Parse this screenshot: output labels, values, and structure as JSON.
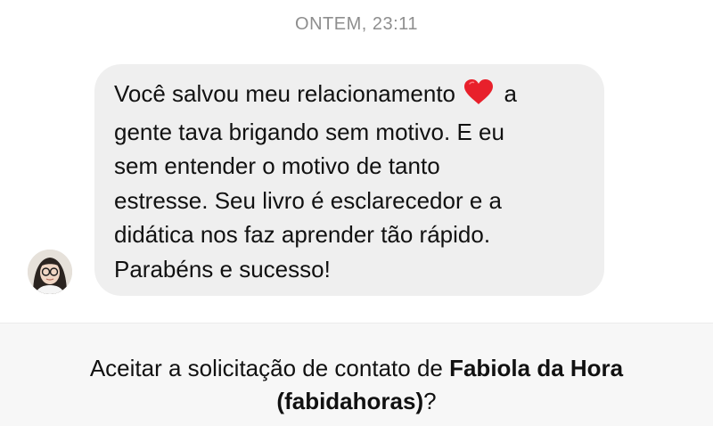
{
  "conversation": {
    "timestamp": "ONTEM, 23:11"
  },
  "message": {
    "avatar_icon": "user-avatar-photo",
    "lines": [
      "Você salvou meu relacionamento",
      "a",
      "gente tava brigando sem motivo. E eu",
      "sem entender o motivo de tanto",
      "estresse. Seu livro é esclarecedor e a",
      "didática nos faz aprender tão rápido.",
      "Parabéns e sucesso!"
    ],
    "emoji": "red-heart-icon"
  },
  "request": {
    "prefix": "Aceitar a solicitação de contato de ",
    "name": "Fabiola da Hora",
    "username": "(fabidahoras)",
    "suffix": "?"
  },
  "colors": {
    "bubble": "#efefef",
    "timestamp": "#8e8e8e",
    "request_bar": "#f7f7f7",
    "heart": "#e8202b"
  }
}
